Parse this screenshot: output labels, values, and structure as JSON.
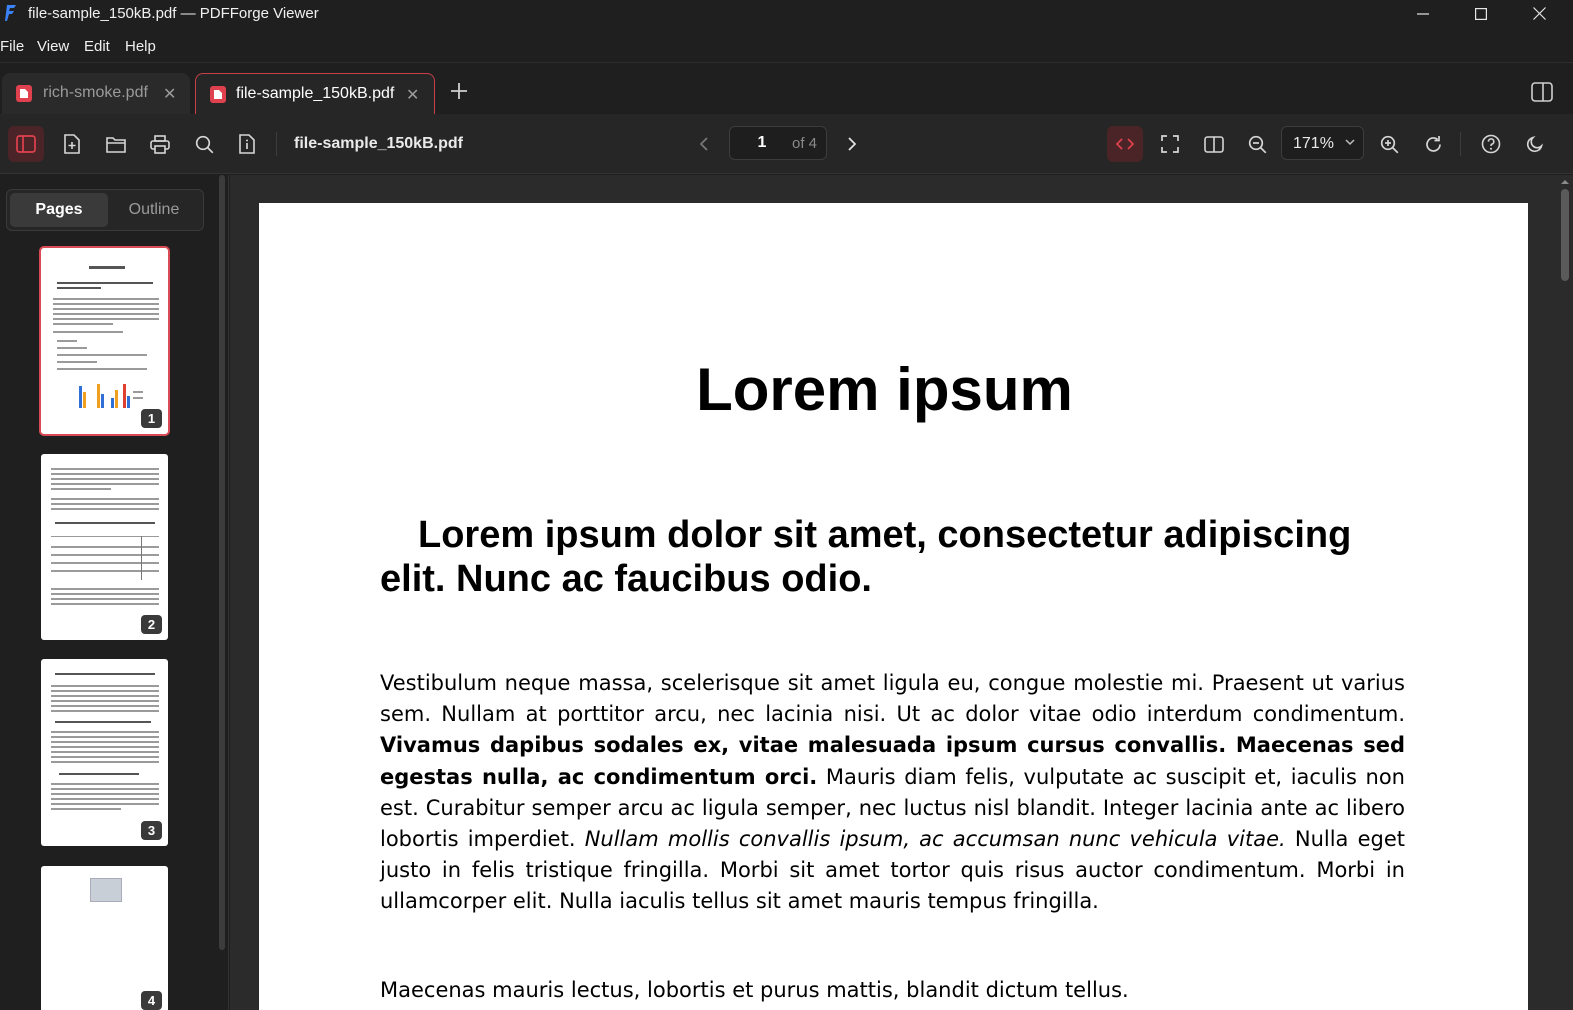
{
  "window": {
    "title": "file-sample_150kB.pdf — PDFForge Viewer"
  },
  "menu": [
    "File",
    "View",
    "Edit",
    "Help"
  ],
  "tabs": [
    {
      "label": "rich-smoke.pdf",
      "active": false
    },
    {
      "label": "file-sample_150kB.pdf",
      "active": true
    }
  ],
  "toolbar": {
    "doc_name": "file-sample_150kB.pdf",
    "page_current": "1",
    "page_total": "of 4",
    "zoom": "171%",
    "accent_color": "#d94a55"
  },
  "sidebar": {
    "tabs": [
      "Pages",
      "Outline"
    ],
    "active_tab": "Pages",
    "thumbnails": [
      "1",
      "2",
      "3",
      "4"
    ]
  },
  "document": {
    "title": "Lorem ipsum",
    "subtitle": "Lorem ipsum dolor sit amet, consectetur adipiscing elit. Nunc ac faucibus odio.",
    "p1_a": "Vestibulum neque massa, scelerisque sit amet ligula eu, congue molestie mi. Praesent ut varius sem. Nullam at porttitor arcu, nec lacinia nisi. Ut ac dolor vitae odio interdum condimentum. ",
    "p1_bold": "Vivamus dapibus sodales ex, vitae malesuada ipsum cursus convallis. Maecenas sed egestas nulla, ac condimentum orci.",
    "p1_b": " Mauris diam felis, vulputate ac suscipit et, iaculis non est. Curabitur semper arcu ac ligula semper, nec luctus nisl blandit. Integer lacinia ante ac libero lobortis imperdiet. ",
    "p1_italic": "Nullam mollis convallis ipsum, ac accumsan nunc vehicula vitae.",
    "p1_c": " Nulla eget justo in felis tristique fringilla. Morbi sit amet tortor quis risus auctor condimentum. Morbi in ullamcorper elit. Nulla iaculis tellus sit amet mauris tempus fringilla.",
    "p2": "Maecenas mauris lectus, lobortis et purus mattis, blandit dictum tellus."
  }
}
